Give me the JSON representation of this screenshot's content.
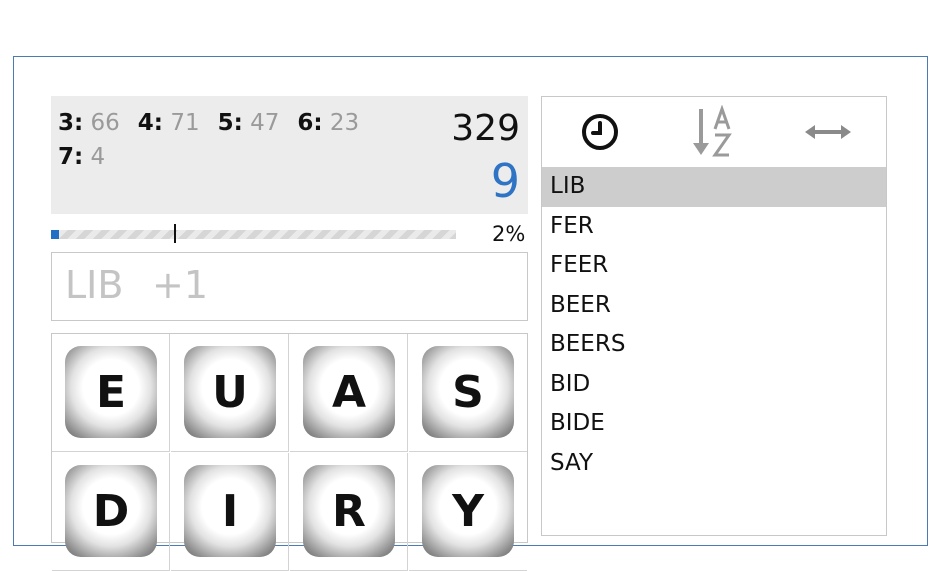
{
  "stats": {
    "counts": [
      {
        "len": "3:",
        "count": "66"
      },
      {
        "len": "4:",
        "count": "71"
      },
      {
        "len": "5:",
        "count": "47"
      },
      {
        "len": "6:",
        "count": "23"
      },
      {
        "len": "7:",
        "count": "4"
      }
    ],
    "total_words": "329",
    "found_words": "9"
  },
  "progress": {
    "percent_label": "2%",
    "fraction": 0.02
  },
  "current_word": {
    "text": "LIB",
    "bonus": "+1"
  },
  "tiles": [
    "E",
    "U",
    "A",
    "S",
    "D",
    "I",
    "R",
    "Y"
  ],
  "word_list": {
    "sort_icons": [
      "clock-icon",
      "sort-alpha-icon",
      "expand-horizontal-icon"
    ],
    "selected_index": 0,
    "items": [
      "LIB",
      "FER",
      "FEER",
      "BEER",
      "BEERS",
      "BID",
      "BIDE",
      "SAY"
    ]
  },
  "colors": {
    "accent_blue": "#2f73c4",
    "frame_border": "#4a7bb7"
  }
}
